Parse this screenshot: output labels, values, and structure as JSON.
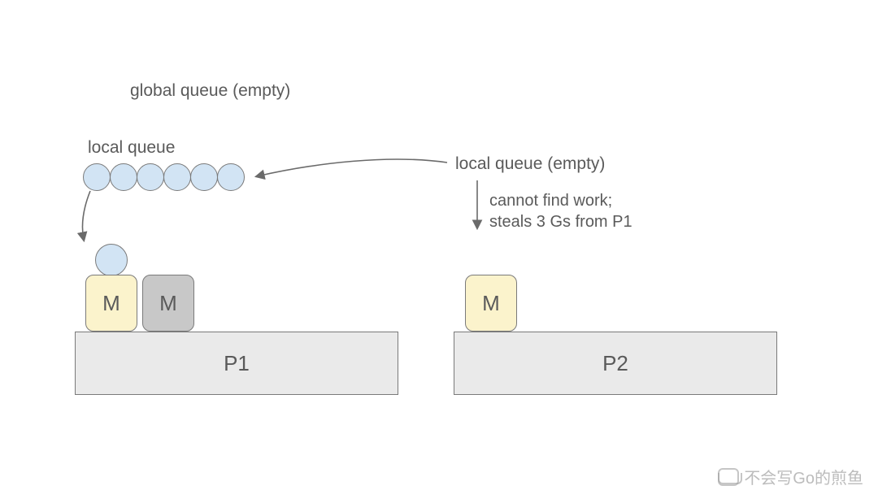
{
  "labels": {
    "global_queue": "global queue (empty)",
    "local_queue_left": "local queue",
    "local_queue_right": "local queue (empty)",
    "steal_note": "cannot find work;\nsteals 3 Gs from P1"
  },
  "boxes": {
    "m_active": "M",
    "m_idle": "M",
    "m_right": "M",
    "p1": "P1",
    "p2": "P2"
  },
  "queue": {
    "count": 6
  },
  "watermark": "不会写Go的煎鱼",
  "colors": {
    "goroutine": "#d2e4f4",
    "m_active": "#fbf3cc",
    "m_idle": "#c8c8c8",
    "processor": "#eaeaea",
    "stroke": "#7a7a7a",
    "text": "#5a5a5a"
  }
}
